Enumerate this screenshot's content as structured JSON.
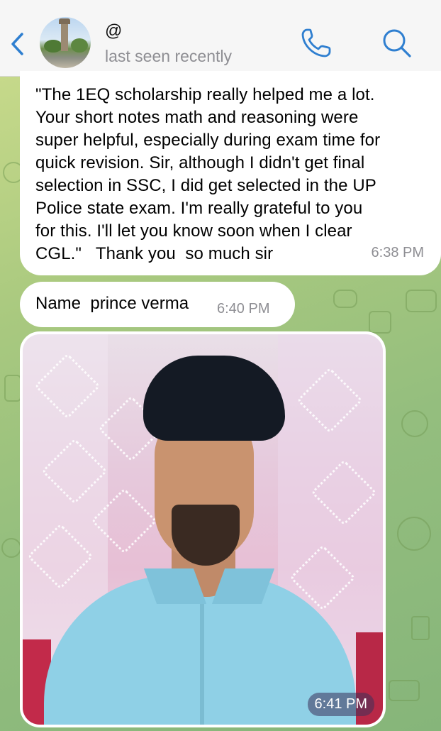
{
  "header": {
    "title": "@",
    "status": "last seen recently",
    "icons": {
      "back": "chevron-left-icon",
      "call": "phone-icon",
      "search": "search-icon"
    }
  },
  "messages": [
    {
      "text": "\"The 1EQ scholarship really helped me a lot.\nYour short notes math and reasoning were\nsuper helpful, especially during exam time for\nquick revision. Sir, although I didn't get final\nselection in SSC, I did get selected in the UP\nPolice state exam. I'm really grateful to you\nfor this. I'll let you know soon when I clear\nCGL.\"   Thank you  so much sir",
      "time": "6:38 PM"
    },
    {
      "text": "Name  prince verma",
      "time": "6:40 PM"
    },
    {
      "type": "photo",
      "time": "6:41 PM"
    }
  ],
  "colors": {
    "accent": "#2f7fd0",
    "bubble": "#ffffff",
    "meta_text": "#8e8e93"
  }
}
